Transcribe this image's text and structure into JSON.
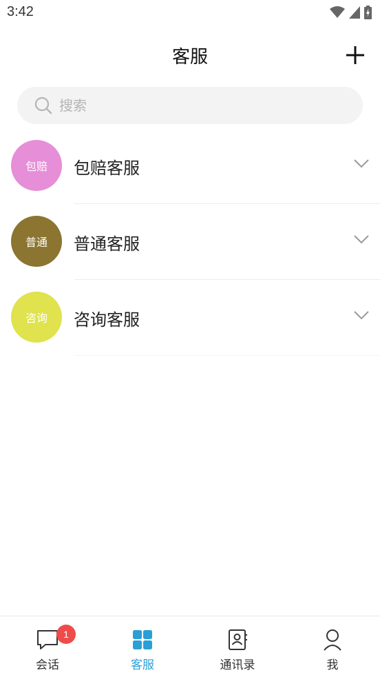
{
  "status_bar": {
    "time": "3:42"
  },
  "header": {
    "title": "客服",
    "add_icon": "plus-icon"
  },
  "search": {
    "placeholder": "搜索",
    "icon": "search-icon"
  },
  "services": [
    {
      "avatar_text": "包赔",
      "name": "包赔客服",
      "color": "#e68ed7"
    },
    {
      "avatar_text": "普通",
      "name": "普通客服",
      "color": "#8b7530"
    },
    {
      "avatar_text": "咨询",
      "name": "咨询客服",
      "color": "#e0e24e"
    }
  ],
  "tab_bar": {
    "tabs": [
      {
        "label": "会话",
        "icon": "chat-bubble-icon",
        "badge": "1",
        "active": false
      },
      {
        "label": "客服",
        "icon": "grid-icon",
        "active": true
      },
      {
        "label": "通讯录",
        "icon": "contacts-icon",
        "active": false
      },
      {
        "label": "我",
        "icon": "person-icon",
        "active": false
      }
    ]
  },
  "colors": {
    "accent": "#2a9fd6",
    "badge": "#ef4b4b"
  }
}
